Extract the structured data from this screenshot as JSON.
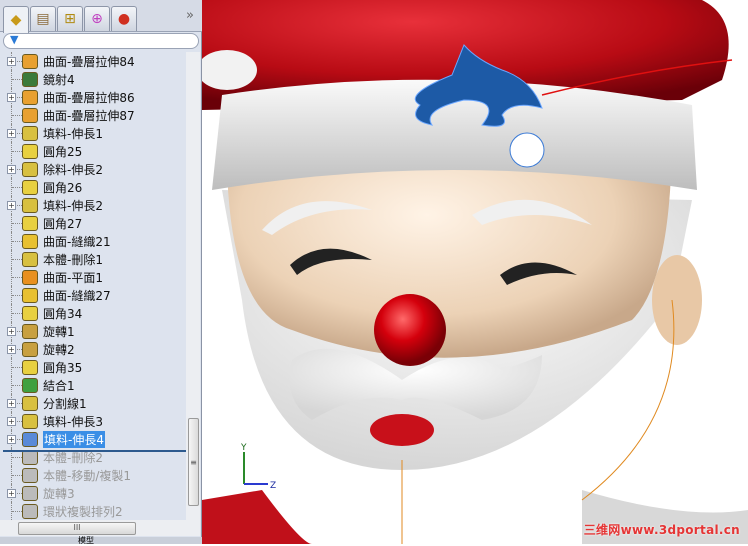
{
  "panel": {
    "tabs": [
      {
        "icon": "feature-manager-icon"
      },
      {
        "icon": "property-manager-icon"
      },
      {
        "icon": "configuration-manager-icon"
      },
      {
        "icon": "dimxpert-icon"
      },
      {
        "icon": "display-manager-icon"
      }
    ],
    "more": "»",
    "filter_icon": "filter-icon",
    "tree": [
      {
        "label": "曲面-疊層拉伸84",
        "exp": true
      },
      {
        "label": "鏡射4",
        "exp": false
      },
      {
        "label": "曲面-疊層拉伸86",
        "exp": true
      },
      {
        "label": "曲面-疊層拉伸87",
        "exp": false
      },
      {
        "label": "填料-伸長1",
        "exp": true
      },
      {
        "label": "圓角25",
        "exp": false
      },
      {
        "label": "除料-伸長2",
        "exp": true
      },
      {
        "label": "圓角26",
        "exp": false
      },
      {
        "label": "填料-伸長2",
        "exp": true
      },
      {
        "label": "圓角27",
        "exp": false
      },
      {
        "label": "曲面-縫織21",
        "exp": false
      },
      {
        "label": "本體-刪除1",
        "exp": false
      },
      {
        "label": "曲面-平面1",
        "exp": false
      },
      {
        "label": "曲面-縫織27",
        "exp": false
      },
      {
        "label": "圓角34",
        "exp": false
      },
      {
        "label": "旋轉1",
        "exp": true
      },
      {
        "label": "旋轉2",
        "exp": true
      },
      {
        "label": "圓角35",
        "exp": false
      },
      {
        "label": "結合1",
        "exp": false
      },
      {
        "label": "分割線1",
        "exp": true
      },
      {
        "label": "填料-伸長3",
        "exp": true
      },
      {
        "label": "填料-伸長4",
        "exp": true,
        "selected": true
      },
      {
        "label": "本體-刪除2",
        "exp": false,
        "suppressed": true
      },
      {
        "label": "本體-移動/複製1",
        "exp": false,
        "suppressed": true
      },
      {
        "label": "旋轉3",
        "exp": true,
        "suppressed": true
      },
      {
        "label": "環狀複製排列2",
        "exp": false,
        "suppressed": true
      }
    ],
    "bottom_tab": "模型"
  },
  "viewport": {
    "triad": {
      "y": "Y",
      "z": "Z"
    },
    "watermark": "三维网www.3dportal.cn"
  },
  "colors": {
    "selection": "#3a8ee6",
    "hat_red": "#c0101a",
    "holly_blue": "#1d5aa6"
  }
}
